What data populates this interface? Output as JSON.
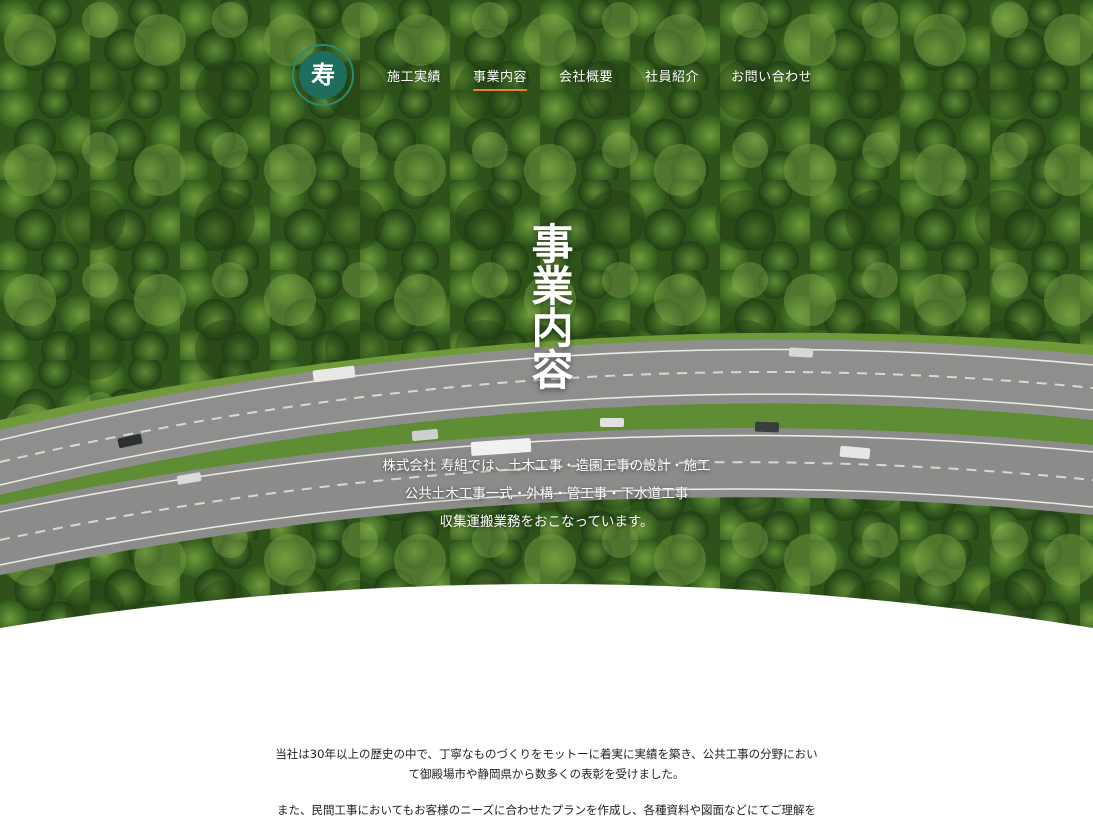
{
  "brand": {
    "logo_char": "寿",
    "logo_color": "#1f6d5c"
  },
  "nav": {
    "items": [
      {
        "label": "施工実績",
        "active": false
      },
      {
        "label": "事業内容",
        "active": true
      },
      {
        "label": "会社概要",
        "active": false
      },
      {
        "label": "社員紹介",
        "active": false
      },
      {
        "label": "お問い合わせ",
        "active": false
      }
    ],
    "active_color": "#e0822e"
  },
  "hero": {
    "title": "事業内容",
    "lead": [
      "株式会社 寿組では、土木工事・造園工事の設計・施工",
      "公共土木工事一式・外構・管工事・下水道工事",
      "収集運搬業務をおこなっています。"
    ]
  },
  "intro": {
    "paragraph1": "当社は30年以上の歴史の中で、丁寧なものづくりをモットーに着実に実績を築き、公共工事の分野において御殿場市や静岡県から数多くの表彰を受けました。",
    "paragraph2": "また、民間工事においてもお客様のニーズに合わせたプランを作成し、各種資料や図面などにてご理解を"
  }
}
